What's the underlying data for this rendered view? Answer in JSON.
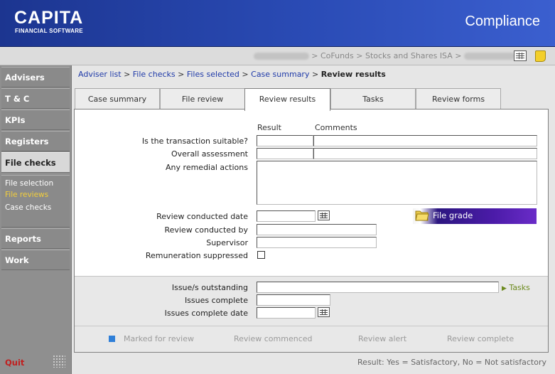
{
  "header": {
    "brand": "CAPITA",
    "brand_sub": "FINANCIAL SOFTWARE",
    "module": "Compliance"
  },
  "context_path": {
    "provider": "CoFunds",
    "product": "Stocks and Shares ISA",
    "sep": ">"
  },
  "sidebar": {
    "items": [
      "Advisers",
      "T & C",
      "KPIs",
      "Registers",
      "File checks",
      "Reports",
      "Work"
    ],
    "sub_items": [
      "File selection",
      "File reviews",
      "Case checks"
    ],
    "quit": "Quit"
  },
  "breadcrumb": {
    "links": [
      "Adviser list",
      "File checks",
      "Files selected",
      "Case summary"
    ],
    "separator": ">",
    "current": "Review results"
  },
  "tabs": [
    "Case summary",
    "File review",
    "Review results",
    "Tasks",
    "Review forms"
  ],
  "form": {
    "col_result": "Result",
    "col_comments": "Comments",
    "q_suitable": "Is the transaction suitable?",
    "q_overall": "Overall assessment",
    "q_remedial": "Any remedial actions",
    "review_date": "Review conducted date",
    "review_by": "Review conducted by",
    "supervisor": "Supervisor",
    "remuneration": "Remuneration suppressed",
    "file_grade": "File grade",
    "issues_outstanding": "Issue/s outstanding",
    "issues_complete": "Issues complete",
    "issues_complete_date": "Issues complete date",
    "tasks_link": "Tasks"
  },
  "legend": [
    "Marked for review",
    "Review commenced",
    "Review alert",
    "Review complete"
  ],
  "footer_note": "Result: Yes = Satisfactory, No = Not satisfactory",
  "colors": {
    "header_blue": "#2a4bb5",
    "grade_purple": "#4b1ba8",
    "tasks_green": "#6c8a1e",
    "marker_blue": "#2f7fd8"
  }
}
